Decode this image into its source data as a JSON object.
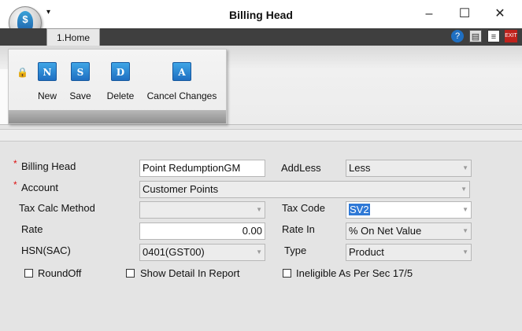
{
  "window": {
    "title": "Billing Head",
    "qat_glyph": "▾",
    "minimize": "–",
    "maximize": "☐",
    "close": "✕"
  },
  "ribbon": {
    "tab": "1.Home",
    "buttons": [
      {
        "label": "New",
        "icon_letter": "N"
      },
      {
        "label": "Save",
        "icon_letter": "S"
      },
      {
        "label": "Delete",
        "icon_letter": "D"
      },
      {
        "label": "Cancel Changes",
        "icon_letter": "A"
      }
    ],
    "header_icons": [
      "help-icon",
      "print-icon",
      "document-icon",
      "exit-icon"
    ]
  },
  "form": {
    "billing_head": {
      "label": "Billing Head",
      "value": "Point RedumptionGM",
      "required": "*"
    },
    "addless": {
      "label": "AddLess",
      "value": "Less"
    },
    "account": {
      "label": "Account",
      "value": "Customer Points",
      "required": "*"
    },
    "tax_calc_method": {
      "label": "Tax Calc Method",
      "value": ""
    },
    "tax_code": {
      "label": "Tax Code",
      "value": "SV2"
    },
    "rate": {
      "label": "Rate",
      "value": "0.00"
    },
    "rate_in": {
      "label": "Rate In",
      "value": "% On Net Value"
    },
    "hsn": {
      "label": "HSN(SAC)",
      "value": "0401(GST00)"
    },
    "type": {
      "label": "Type",
      "value": "Product"
    },
    "roundoff": {
      "label": "RoundOff",
      "checked": false
    },
    "show_detail": {
      "label": "Show Detail In Report",
      "checked": false
    },
    "ineligible": {
      "label": "Ineligible As Per Sec 17/5",
      "checked": false
    }
  },
  "colors": {
    "selection": "#2f79d6",
    "ribbon_button": "#1f6fc2",
    "tabstrip": "#3f3f3f"
  }
}
